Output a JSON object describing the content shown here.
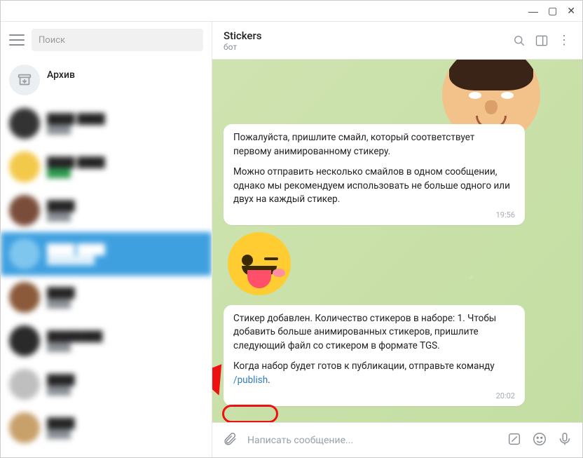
{
  "titlebar": {
    "minimize": "—",
    "maximize": "▢",
    "close": "✕"
  },
  "sidebar": {
    "search_placeholder": "Поиск",
    "archive_label": "Архив"
  },
  "chat": {
    "name": "Stickers",
    "status": "бот",
    "msg1_p1": "Пожалуйста, пришлите смайл, который соответствует первому анимированному стикеру.",
    "msg1_p2": "Можно отправить несколько смайлов в одном сообщении, однако мы рекомендуем использовать не больше одного или двух на каждый стикер.",
    "msg1_time": "19:56",
    "msg2_p1": "Стикер добавлен. Количество стикеров в наборе: 1. Чтобы добавить больше анимированных стикеров, пришлите следующий файл со стикером в формате TGS.",
    "msg2_p2_a": "Когда набор будет готов к публикации, отправьте команду ",
    "msg2_cmd": "/publish",
    "msg2_p2_b": ".",
    "msg2_time": "20:02",
    "compose_placeholder": "Написать сообщение..."
  }
}
